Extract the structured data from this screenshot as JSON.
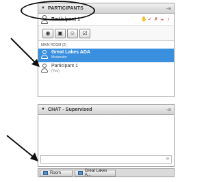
{
  "participants_pod": {
    "title": "PARTICIPANTS",
    "menu_icon": "pod-menu-icon",
    "current_user": "Participant 1",
    "status_icons": [
      "raise-hand-icon",
      "agree-icon",
      "disagree-icon",
      "step-away-icon",
      "speak-louder-icon"
    ],
    "toolbar": [
      "speaker-icon",
      "camera-icon",
      "status-icon",
      "checklist-icon"
    ],
    "room_label": "MAIN ROOM (2)",
    "attendees": [
      {
        "name": "Great Lakes ADA",
        "role": "Moderator",
        "selected": true
      },
      {
        "name": "Participant 1",
        "role": "(You)",
        "selected": false
      }
    ]
  },
  "chat_pod": {
    "title": "CHAT - Supervised",
    "input_value": "",
    "input_placeholder": ""
  },
  "taskbar": {
    "tabs": [
      {
        "label": "Room"
      },
      {
        "label": "Great Lakes A..."
      }
    ]
  },
  "colors": {
    "selection": "#3a8fde",
    "header_bg": "#d2d2d2"
  }
}
